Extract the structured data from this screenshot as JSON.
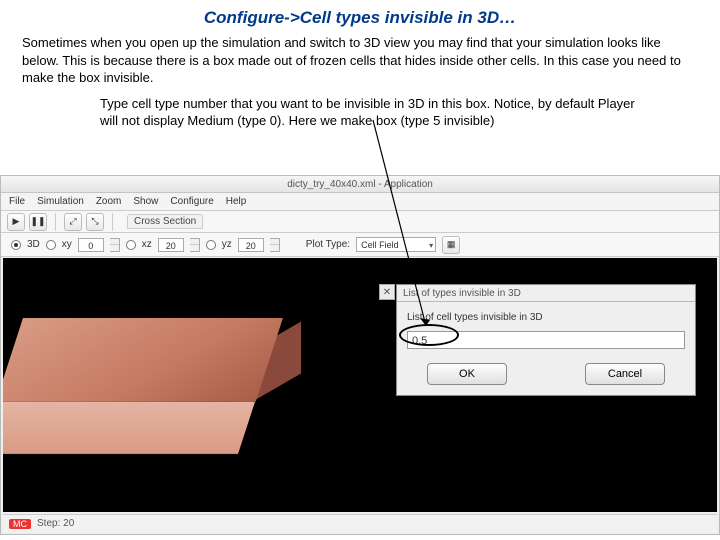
{
  "title": "Configure->Cell types invisible in 3D…",
  "para1": "Sometimes when you open up the simulation and switch to 3D view you may find that your simulation looks like below. This is because there is a box made out of frozen cells that hides inside other cells. In this case you need to make the box invisible.",
  "para2": "Type cell type number that you want to be invisible in 3D in this box. Notice, by default Player will not display Medium (type 0). Here we make box (type 5 invisible)",
  "app": {
    "window_title": "dicty_try_40x40.xml - Application",
    "menu": {
      "file": "File",
      "simulation": "Simulation",
      "zoom": "Zoom",
      "show": "Show",
      "configure": "Configure",
      "help": "Help"
    },
    "section_label": "Cross Section",
    "play": "▶",
    "pause": "❚❚",
    "zoom_in": "⤢",
    "zoom_out": "⤡",
    "proj": {
      "d3": "3D",
      "xy": "xy",
      "xz": "xz",
      "yz": "yz",
      "xy_val": "0",
      "xz_val": "20",
      "yz_val": "20"
    },
    "plot": {
      "label": "Plot Type:",
      "value": "Cell Field"
    },
    "status_badge": "MC",
    "status_text": "Step: 20"
  },
  "dialog": {
    "title": "List of types invisible in 3D",
    "label": "List of cell types invisible in 3D",
    "value": "0,5",
    "ok": "OK",
    "cancel": "Cancel"
  }
}
